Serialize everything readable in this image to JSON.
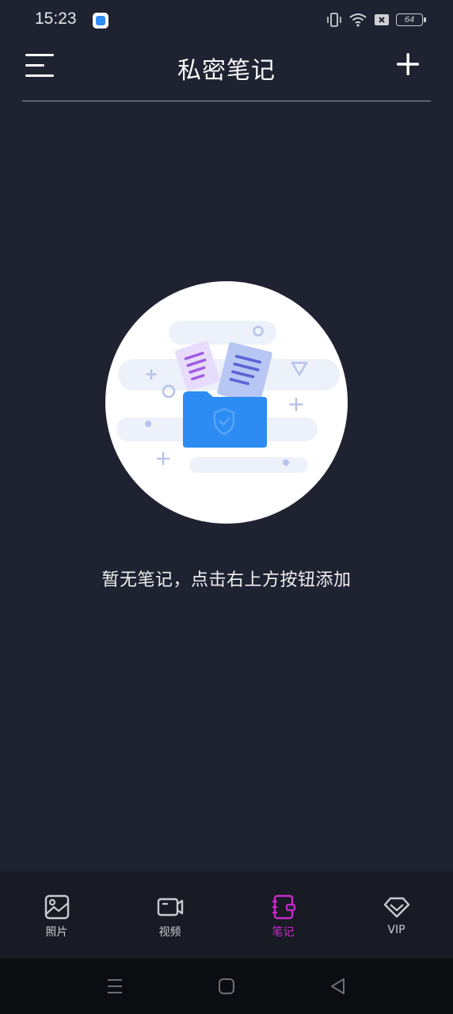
{
  "status_bar": {
    "time": "15:23",
    "battery": "64"
  },
  "header": {
    "title": "私密笔记"
  },
  "empty_state": {
    "message": "暂无笔记，点击右上方按钮添加"
  },
  "bottom_nav": {
    "items": [
      {
        "label": "照片",
        "icon": "photo-icon",
        "active": false
      },
      {
        "label": "视频",
        "icon": "video-icon",
        "active": false
      },
      {
        "label": "笔记",
        "icon": "notebook-icon",
        "active": true
      },
      {
        "label": "VIP",
        "icon": "diamond-icon",
        "active": false
      }
    ]
  },
  "colors": {
    "background": "#1f2230",
    "accent": "#c72ac9",
    "folder": "#2c8cf4"
  }
}
